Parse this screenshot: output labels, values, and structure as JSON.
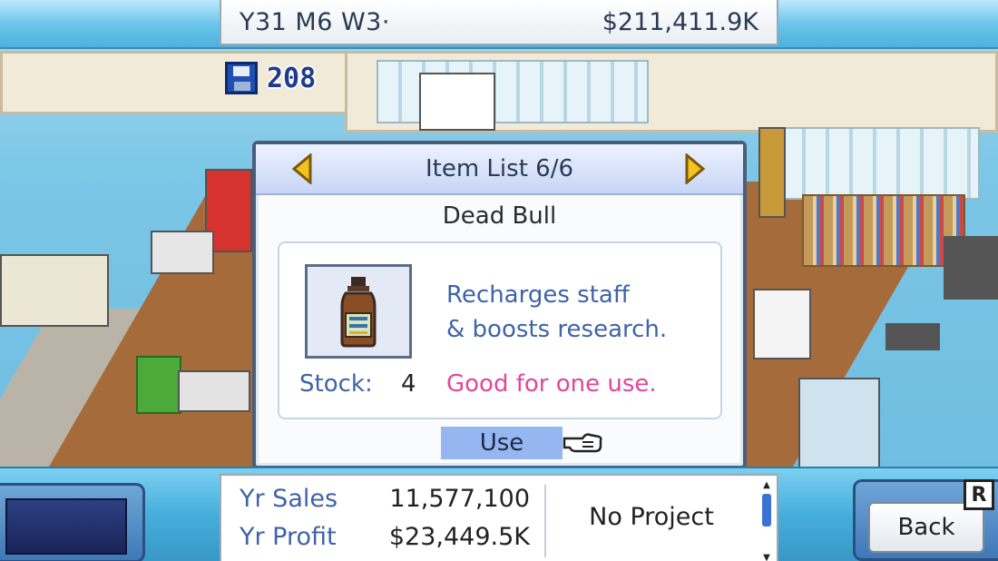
{
  "header": {
    "date": "Y31 M6 W3·",
    "money": "$211,411.9K"
  },
  "research_data": {
    "count": "208",
    "icon": "floppy-disk-icon"
  },
  "dialog": {
    "title": "Item List 6/6",
    "item": {
      "name": "Dead Bull",
      "description_line1": "Recharges staff",
      "description_line2": "& boosts research.",
      "stock_label": "Stock:",
      "stock_value": "4",
      "note": "Good for one use.",
      "icon": "energy-drink-bottle-icon"
    },
    "use_label": "Use",
    "prev_icon": "arrow-left-icon",
    "next_icon": "arrow-right-icon",
    "pointer_icon": "pointing-hand-icon"
  },
  "stats": {
    "sales_label": "Yr Sales",
    "sales_value": "11,577,100",
    "profit_label": "Yr Profit",
    "profit_value": "$23,449.5K",
    "project": "No Project"
  },
  "controls": {
    "back_label": "Back",
    "r_key": "R"
  },
  "colors": {
    "accent_blue": "#3f63a8",
    "note_pink": "#e0479a",
    "use_button": "#96b6f2",
    "title_bar": "#4eb1dd"
  }
}
